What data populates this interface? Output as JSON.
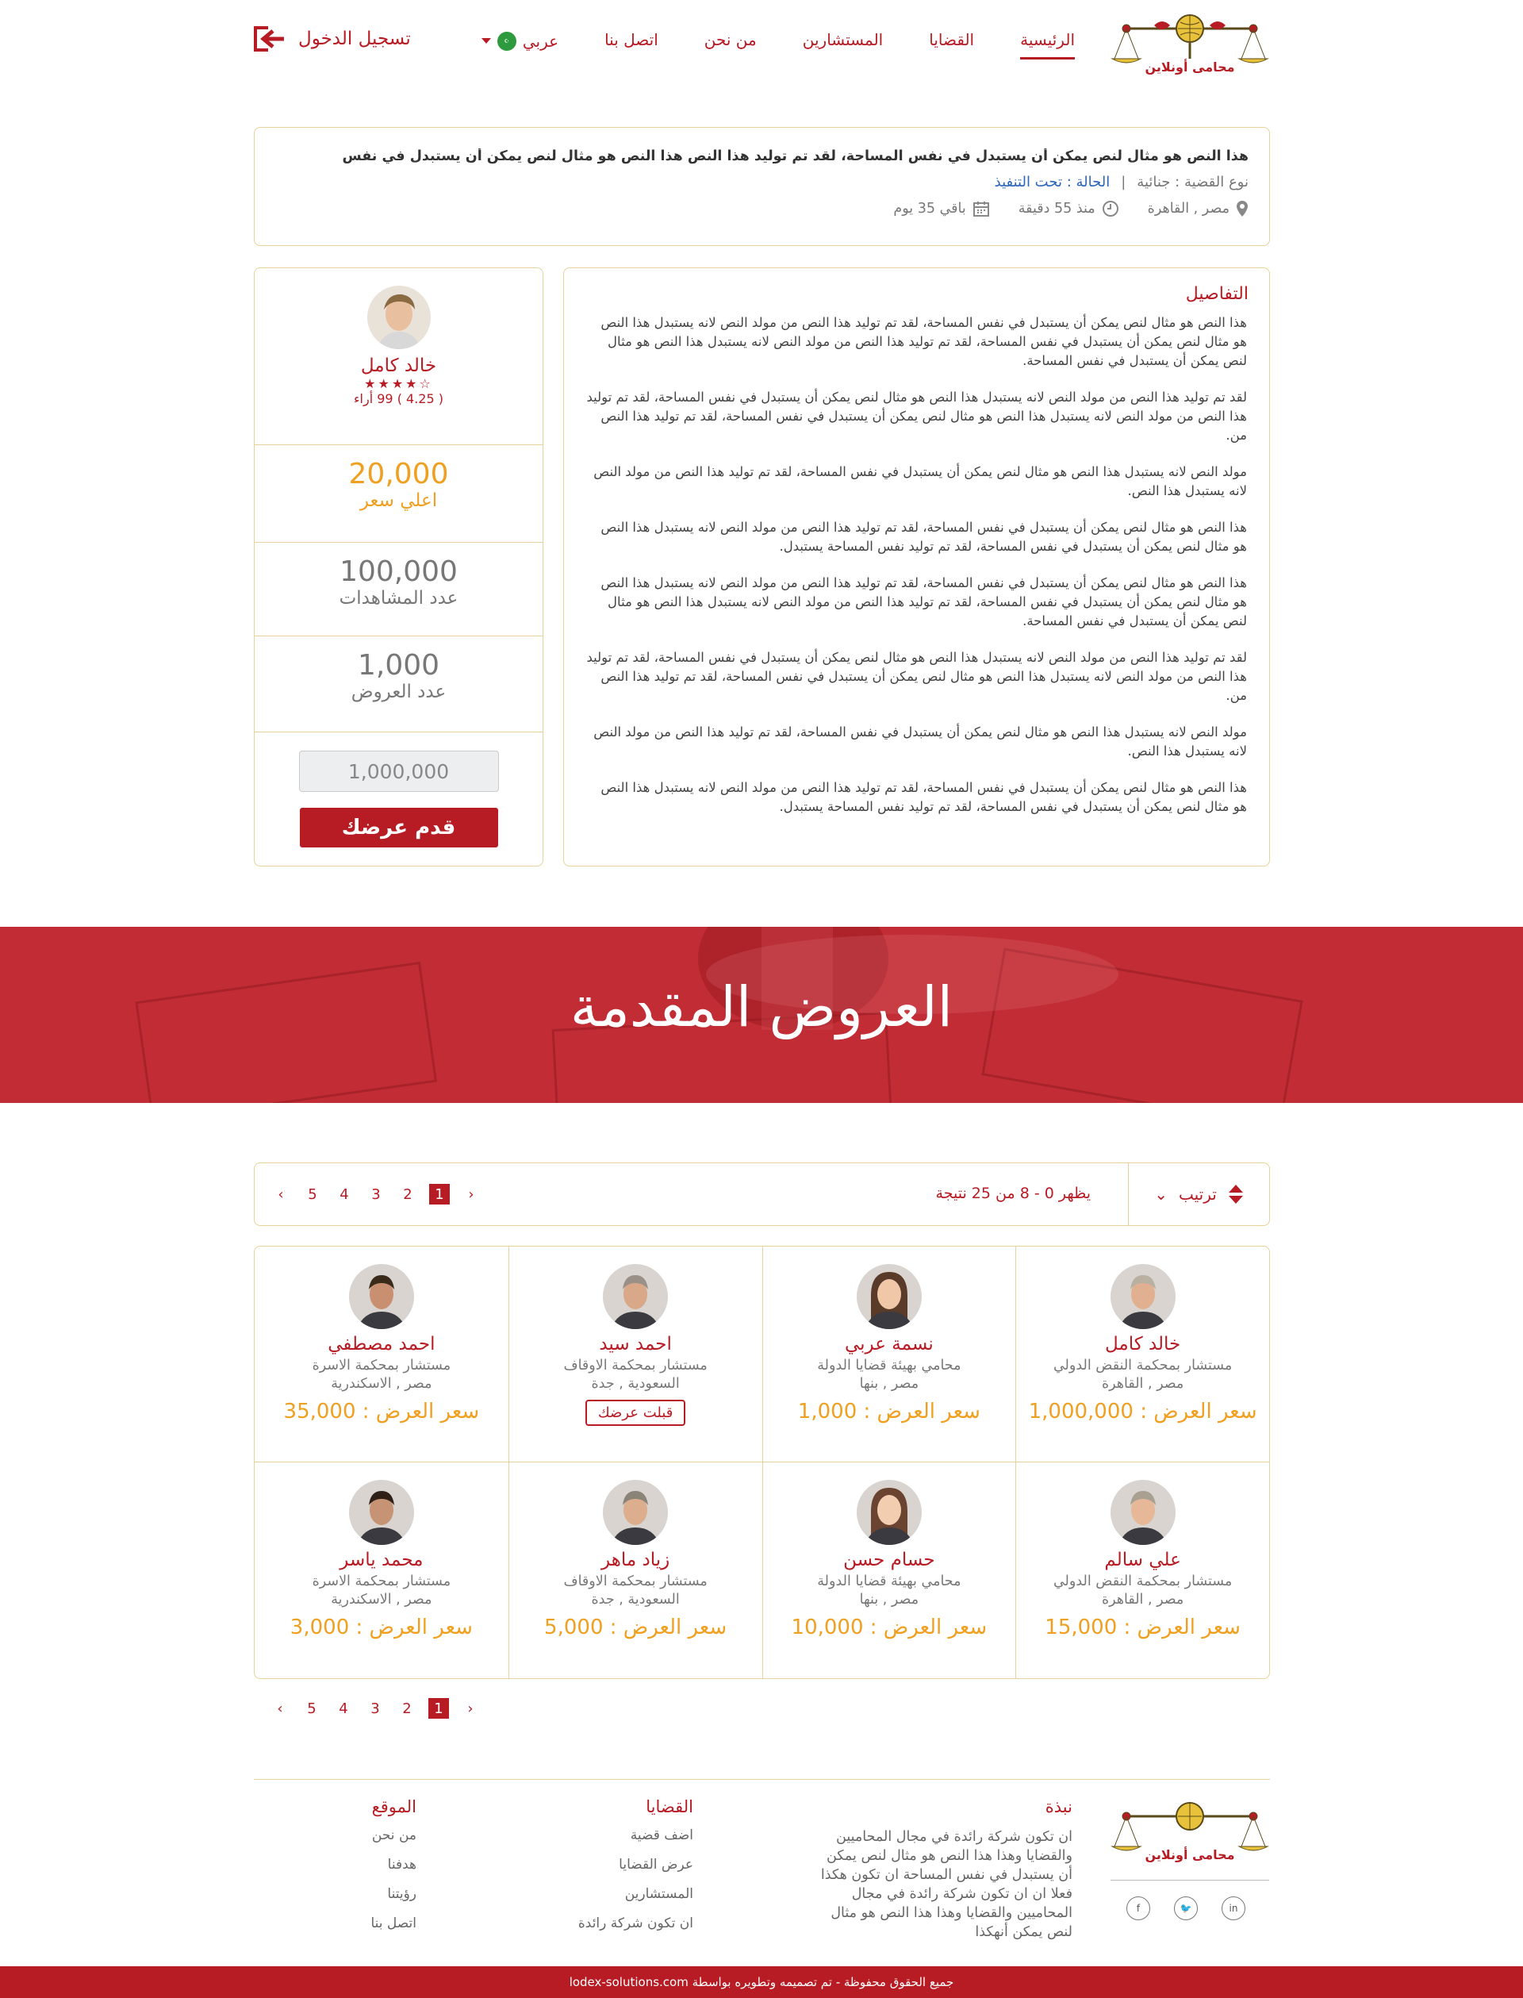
{
  "header": {
    "brand": "محامى أونلاين",
    "nav": [
      "الرئيسية",
      "القضايا",
      "المستشارين",
      "من نحن",
      "اتصل بنا"
    ],
    "language": "عربي",
    "login": "تسجيل الدخول"
  },
  "case": {
    "title": "هذا النص هو مثال لنص يمكن أن يستبدل في نفس المساحة، لقد تم توليد هذا النص هذا النص هو مثال لنص يمكن أن يستبدل في نفس",
    "type": "نوع القضية : جنائية",
    "status": "الحالة : تحت التنفيذ",
    "location": "مصر , القاهرة",
    "since": "منذ 55 دقيقة",
    "remaining": "باقي 35 يوم"
  },
  "details": {
    "heading": "التفاصيل",
    "paragraphs": [
      "هذا النص هو مثال لنص يمكن أن يستبدل في نفس المساحة، لقد تم توليد هذا النص من مولد النص لانه يستبدل هذا النص هو مثال لنص يمكن أن يستبدل في نفس المساحة، لقد تم توليد هذا النص من مولد النص لانه يستبدل هذا النص هو مثال لنص يمكن أن يستبدل في نفس المساحة.",
      "لقد تم توليد هذا النص من مولد النص لانه يستبدل هذا النص هو مثال لنص يمكن أن يستبدل في نفس المساحة، لقد تم توليد هذا النص من مولد النص لانه يستبدل هذا النص هو مثال لنص يمكن أن يستبدل في نفس المساحة، لقد تم توليد هذا النص من.",
      "مولد النص لانه يستبدل هذا النص هو مثال لنص يمكن أن يستبدل في نفس المساحة، لقد تم توليد هذا النص من مولد النص لانه يستبدل هذا النص.",
      "هذا النص هو مثال لنص يمكن أن يستبدل في نفس المساحة، لقد تم توليد هذا النص من مولد النص لانه يستبدل هذا النص هو مثال لنص يمكن أن يستبدل في نفس المساحة، لقد تم توليد نفس المساحة يستبدل.",
      "هذا النص هو مثال لنص يمكن أن يستبدل في نفس المساحة، لقد تم توليد هذا النص من مولد النص لانه يستبدل هذا النص هو مثال لنص يمكن أن يستبدل في نفس المساحة، لقد تم توليد هذا النص من مولد النص لانه يستبدل هذا النص هو مثال لنص يمكن أن يستبدل في نفس المساحة.",
      "لقد تم توليد هذا النص من مولد النص لانه يستبدل هذا النص هو مثال لنص يمكن أن يستبدل في نفس المساحة، لقد تم توليد هذا النص من مولد النص لانه يستبدل هذا النص هو مثال لنص يمكن أن يستبدل في نفس المساحة، لقد تم توليد هذا النص من.",
      "مولد النص لانه يستبدل هذا النص هو مثال لنص يمكن أن يستبدل في نفس المساحة، لقد تم توليد هذا النص من مولد النص لانه يستبدل هذا النص.",
      "هذا النص هو مثال لنص يمكن أن يستبدل في نفس المساحة، لقد تم توليد هذا النص من مولد النص لانه يستبدل هذا النص هو مثال لنص يمكن أن يستبدل في نفس المساحة، لقد تم توليد نفس المساحة يستبدل."
    ]
  },
  "profile": {
    "name": "خالد كامل",
    "rating": "( 4.25 ) 99 أراء",
    "rating_stars": 4,
    "max_price": "20,000",
    "max_price_label": "اعلي سعر",
    "views": "100,000",
    "views_label": "عدد المشاهدات",
    "offers": "1,000",
    "offers_label": "عدد العروض",
    "input_placeholder": "1,000,000",
    "submit": "قدم عرضك"
  },
  "banner": {
    "title": "العروض المقدمة"
  },
  "toolbar": {
    "sort": "ترتيب",
    "results": "يظهر 0 - 8 من 25 نتيجة",
    "pages": [
      "1",
      "2",
      "3",
      "4",
      "5"
    ],
    "active_page": "1"
  },
  "offers": [
    {
      "name": "خالد كامل",
      "role": "مستشار بمحكمة النقض الدولي",
      "loc": "مصر , القاهرة",
      "price": "سعر العرض : 1,000,000",
      "accepted": false
    },
    {
      "name": "نسمة عربي",
      "role": "محامي بهيئة قضايا الدولة",
      "loc": "مصر , بنها",
      "price": "سعر العرض : 1,000",
      "accepted": false
    },
    {
      "name": "احمد سيد",
      "role": "مستشار بمحكمة الاوقاف",
      "loc": "السعودية , جدة",
      "price": "",
      "accepted": true,
      "accepted_label": "قبلت عرضك"
    },
    {
      "name": "احمد مصطفي",
      "role": "مستشار بمحكمة الاسرة",
      "loc": "مصر , الاسكندرية",
      "price": "سعر العرض : 35,000",
      "accepted": false
    },
    {
      "name": "علي سالم",
      "role": "مستشار بمحكمة النقض الدولي",
      "loc": "مصر , القاهرة",
      "price": "سعر العرض : 15,000",
      "accepted": false
    },
    {
      "name": "حسام حسن",
      "role": "محامي بهيئة قضايا الدولة",
      "loc": "مصر , بنها",
      "price": "سعر العرض : 10,000",
      "accepted": false
    },
    {
      "name": "زياد ماهر",
      "role": "مستشار بمحكمة الاوقاف",
      "loc": "السعودية , جدة",
      "price": "سعر العرض : 5,000",
      "accepted": false
    },
    {
      "name": "محمد ياسر",
      "role": "مستشار بمحكمة الاسرة",
      "loc": "مصر , الاسكندرية",
      "price": "سعر العرض : 3,000",
      "accepted": false
    }
  ],
  "footer": {
    "about_title": "نبذة",
    "about_text": "ان تكون شركة رائدة في مجال المحاميين والقضايا وهذا هذا النص هو مثال لنص يمكن أن يستبدل في نفس المساحة ان تكون هكذا فعلا ان ان تكون شركة رائدة في مجال المحاميين والقضايا وهذا هذا النص هو مثال لنص يمكن أنهكذا",
    "cases_title": "القضايا",
    "cases_links": [
      "اضف قضية",
      "عرض القضايا",
      "المستشارين",
      "ان تكون شركة رائدة"
    ],
    "site_title": "الموقع",
    "site_links": [
      "من نحن",
      "هدفنا",
      "رؤيتنا",
      "اتصل بنا"
    ],
    "copyright": "جميع الحقوق محفوظة - تم تصميمه وتطويره بواسطة lodex-solutions.com"
  },
  "colors": {
    "accent": "#b71c24",
    "gold": "#f0a020",
    "border": "#e7d29a",
    "status_blue": "#2a66b8"
  }
}
